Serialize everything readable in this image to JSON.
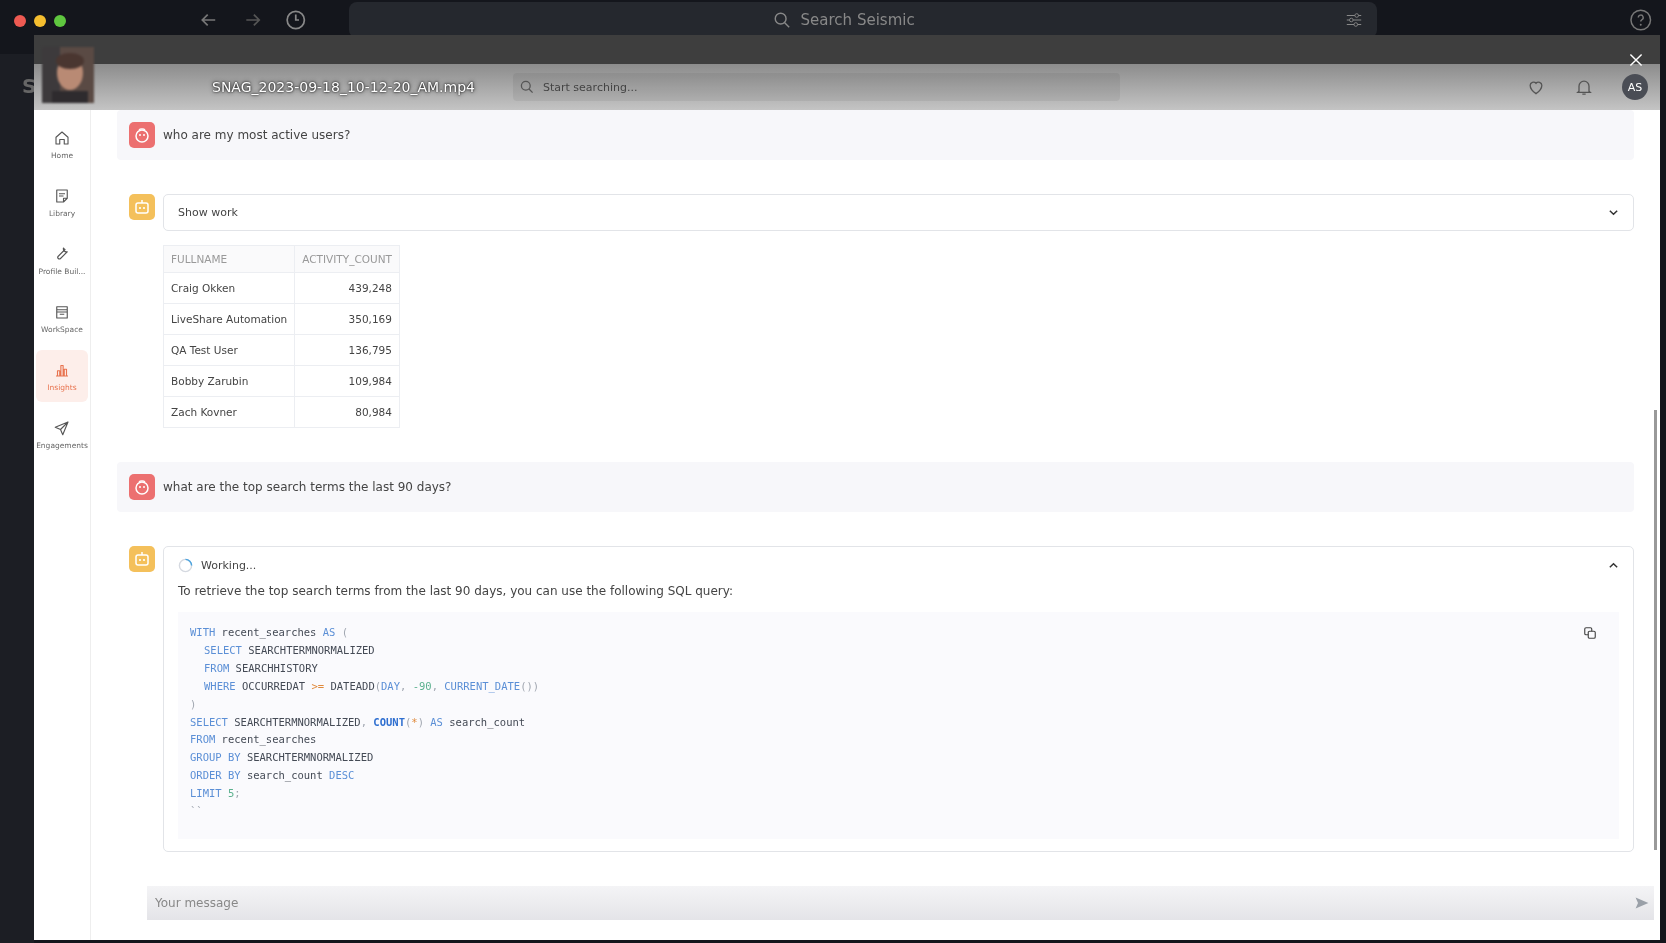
{
  "browser": {
    "rail_letter": "S",
    "search_placeholder": "Search Seismic"
  },
  "player": {
    "filename": "SNAG_2023-09-18_10-12-20_AM.mp4",
    "search_placeholder": "Start searching...",
    "avatar_initials": "AS"
  },
  "sidebar": {
    "items": [
      {
        "label": "Home",
        "selected": false
      },
      {
        "label": "Library",
        "selected": false
      },
      {
        "label": "Profile Buil...",
        "selected": false
      },
      {
        "label": "WorkSpace",
        "selected": false
      },
      {
        "label": "Insights",
        "selected": true
      },
      {
        "label": "Engagements",
        "selected": false
      }
    ]
  },
  "chat": [
    {
      "kind": "user",
      "text": "who are my most active users?"
    },
    {
      "kind": "bot",
      "header": "Show work",
      "working": false,
      "expanded": false,
      "table": {
        "columns": [
          "FULLNAME",
          "ACTIVITY_COUNT"
        ],
        "rows": [
          [
            "Craig Okken",
            "439,248"
          ],
          [
            "LiveShare Automation",
            "350,169"
          ],
          [
            "QA Test User",
            "136,795"
          ],
          [
            "Bobby Zarubin",
            "109,984"
          ],
          [
            "Zach Kovner",
            "80,984"
          ]
        ]
      }
    },
    {
      "kind": "user",
      "text": "what are the top search terms the last 90 days?"
    },
    {
      "kind": "bot",
      "header": "Working...",
      "working": true,
      "expanded": true,
      "text": "To retrieve the top search terms from the last 90 days, you can use the following SQL query:",
      "code": [
        {
          "indent": false,
          "tokens": [
            {
              "text": "WITH",
              "kind": "kw"
            },
            {
              "text": " recent_searches ",
              "kind": "id"
            },
            {
              "text": "AS",
              "kind": "kw"
            },
            {
              "text": " (",
              "kind": "punct"
            }
          ]
        },
        {
          "indent": true,
          "tokens": [
            {
              "text": "SELECT",
              "kind": "kw"
            },
            {
              "text": " SEARCHTERMNORMALIZED",
              "kind": "id"
            }
          ]
        },
        {
          "indent": true,
          "tokens": [
            {
              "text": "FROM",
              "kind": "kw"
            },
            {
              "text": " SEARCHHISTORY",
              "kind": "id"
            }
          ]
        },
        {
          "indent": true,
          "tokens": [
            {
              "text": "WHERE",
              "kind": "kw"
            },
            {
              "text": " OCCURREDAT ",
              "kind": "id"
            },
            {
              "text": ">=",
              "kind": "op"
            },
            {
              "text": " DATEADD",
              "kind": "id"
            },
            {
              "text": "(",
              "kind": "punct"
            },
            {
              "text": "DAY",
              "kind": "kw"
            },
            {
              "text": ", ",
              "kind": "punct"
            },
            {
              "text": "-90",
              "kind": "num"
            },
            {
              "text": ", ",
              "kind": "punct"
            },
            {
              "text": "CURRENT_DATE",
              "kind": "kw"
            },
            {
              "text": "())",
              "kind": "punct"
            }
          ]
        },
        {
          "indent": false,
          "tokens": [
            {
              "text": ")",
              "kind": "punct"
            }
          ]
        },
        {
          "indent": false,
          "tokens": [
            {
              "text": "SELECT",
              "kind": "kw"
            },
            {
              "text": " SEARCHTERMNORMALIZED",
              "kind": "id"
            },
            {
              "text": ", ",
              "kind": "punct"
            },
            {
              "text": "COUNT",
              "kind": "fn"
            },
            {
              "text": "(",
              "kind": "punct"
            },
            {
              "text": "*",
              "kind": "op"
            },
            {
              "text": ") ",
              "kind": "punct"
            },
            {
              "text": "AS",
              "kind": "kw"
            },
            {
              "text": " search_count",
              "kind": "id"
            }
          ]
        },
        {
          "indent": false,
          "tokens": [
            {
              "text": "FROM",
              "kind": "kw"
            },
            {
              "text": " recent_searches",
              "kind": "id"
            }
          ]
        },
        {
          "indent": false,
          "tokens": [
            {
              "text": "GROUP BY",
              "kind": "kw"
            },
            {
              "text": " SEARCHTERMNORMALIZED",
              "kind": "id"
            }
          ]
        },
        {
          "indent": false,
          "tokens": [
            {
              "text": "ORDER BY",
              "kind": "kw"
            },
            {
              "text": " search_count ",
              "kind": "id"
            },
            {
              "text": "DESC",
              "kind": "kw"
            }
          ]
        },
        {
          "indent": false,
          "tokens": [
            {
              "text": "LIMIT",
              "kind": "kw"
            },
            {
              "text": " 5",
              "kind": "num"
            },
            {
              "text": ";",
              "kind": "punct"
            }
          ]
        },
        {
          "indent": false,
          "tokens": [
            {
              "text": "``",
              "kind": "punct"
            }
          ]
        }
      ]
    }
  ],
  "composer": {
    "placeholder": "Your message"
  }
}
